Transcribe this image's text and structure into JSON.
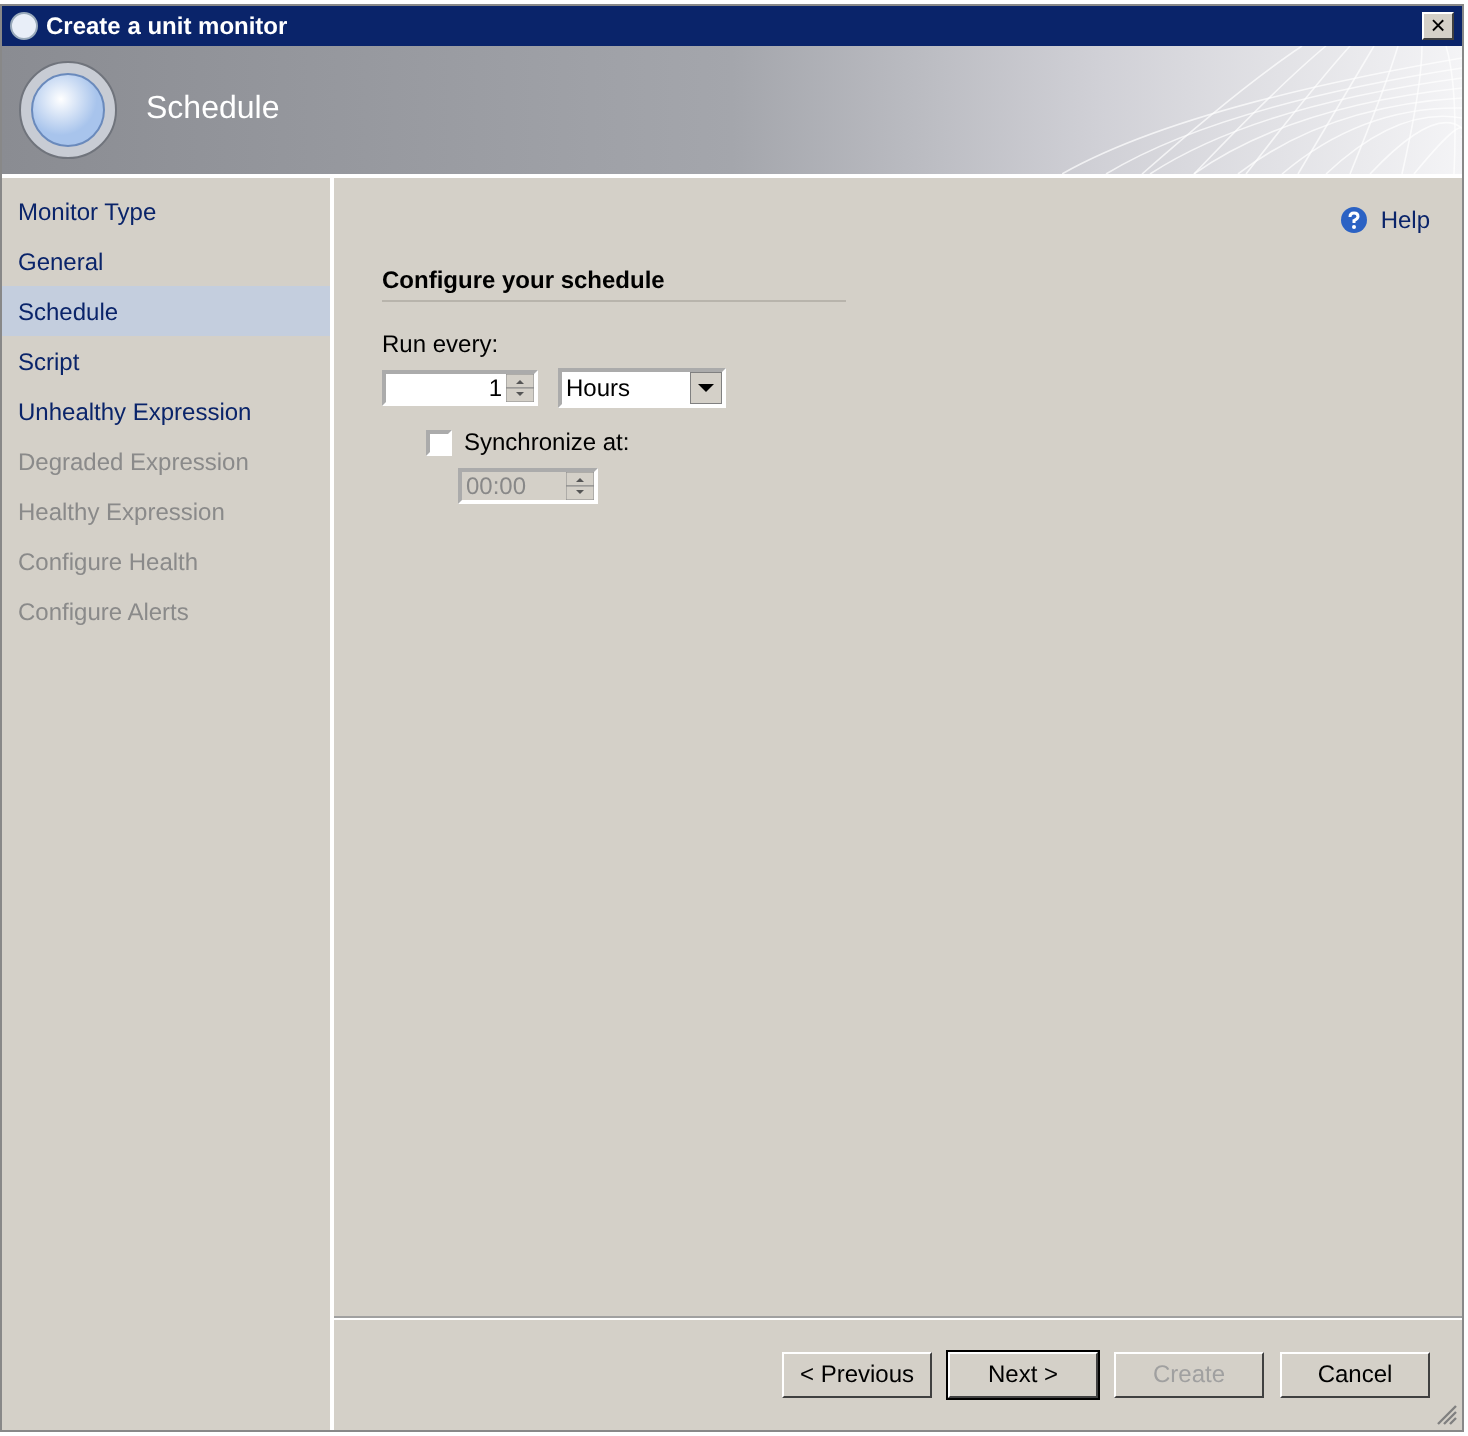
{
  "window": {
    "title": "Create a unit monitor",
    "close_label": "×"
  },
  "header": {
    "title": "Schedule"
  },
  "sidebar": {
    "items": [
      {
        "label": "Monitor Type",
        "selected": false,
        "disabled": false
      },
      {
        "label": "General",
        "selected": false,
        "disabled": false
      },
      {
        "label": "Schedule",
        "selected": true,
        "disabled": false
      },
      {
        "label": "Script",
        "selected": false,
        "disabled": false
      },
      {
        "label": "Unhealthy Expression",
        "selected": false,
        "disabled": false
      },
      {
        "label": "Degraded Expression",
        "selected": false,
        "disabled": true
      },
      {
        "label": "Healthy Expression",
        "selected": false,
        "disabled": true
      },
      {
        "label": "Configure Health",
        "selected": false,
        "disabled": true
      },
      {
        "label": "Configure Alerts",
        "selected": false,
        "disabled": true
      }
    ]
  },
  "help": {
    "label": "Help"
  },
  "section": {
    "title": "Configure your schedule",
    "run_every_label": "Run every:",
    "interval": "1",
    "unit": "Hours",
    "synchronize": {
      "label": "Synchronize at:",
      "checked": false,
      "time": "00:00",
      "disabled": true
    }
  },
  "buttons": [
    {
      "label": "< Previous",
      "default": false,
      "disabled": false
    },
    {
      "label": "Next >",
      "default": true,
      "disabled": false
    },
    {
      "label": "Create",
      "default": false,
      "disabled": true
    },
    {
      "label": "Cancel",
      "default": false,
      "disabled": false
    }
  ]
}
